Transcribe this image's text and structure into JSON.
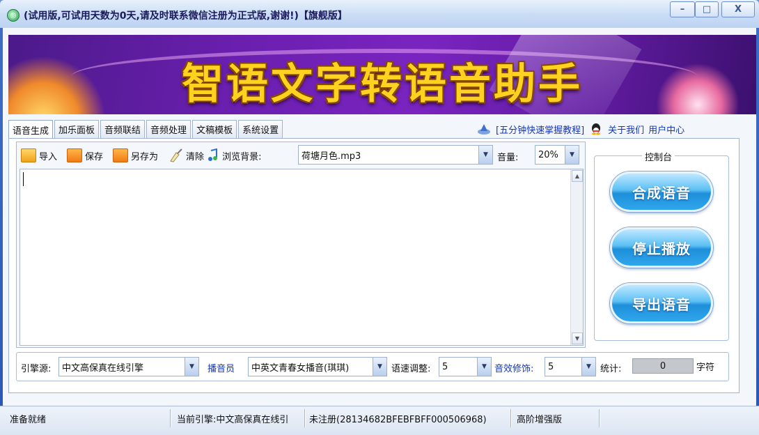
{
  "window": {
    "title": "(试用版,可试用天数为0天,请及时联系微信注册为正式版,谢谢!)【旗舰版】",
    "min": "–",
    "max": "□",
    "close": "X"
  },
  "banner": {
    "title": "智语文字转语音助手"
  },
  "tabs": [
    "语音生成",
    "加乐面板",
    "音频联结",
    "音频处理",
    "文稿模板",
    "系统设置"
  ],
  "toplinks": {
    "tutorial": "[五分钟快速掌握教程]",
    "about": "关于我们",
    "user_center": "用户中心"
  },
  "toolbar": {
    "import": "导入",
    "save": "保存",
    "save_as": "另存为",
    "clear": "清除",
    "browse_bg": "浏览背景:",
    "bg_file": "荷塘月色.mp3",
    "volume_label": "音量:",
    "volume_value": "20%"
  },
  "editor": {
    "content": ""
  },
  "console": {
    "legend": "控制台",
    "synthesize": "合成语音",
    "stop": "停止播放",
    "export": "导出语音"
  },
  "settings": {
    "engine_label": "引擎源:",
    "engine_value": "中文高保真在线引擎",
    "voice_label": "播音员",
    "voice_value": "中英文青春女播音(琪琪)",
    "speed_label": "语速调整:",
    "speed_value": "5",
    "effect_label": "音效修饰:",
    "effect_value": "5",
    "count_label": "统计:",
    "count_value": "0",
    "count_unit": "字符"
  },
  "status": {
    "ready": "准备就绪",
    "engine": "当前引擎:中文高保真在线引",
    "reg": "未注册(28134682BFEBFBFF000506968)",
    "edition": "高阶增强版"
  },
  "colors": {
    "link": "#1636b8",
    "banner_text": "#ffd21f",
    "button": "#2fa6ec"
  }
}
